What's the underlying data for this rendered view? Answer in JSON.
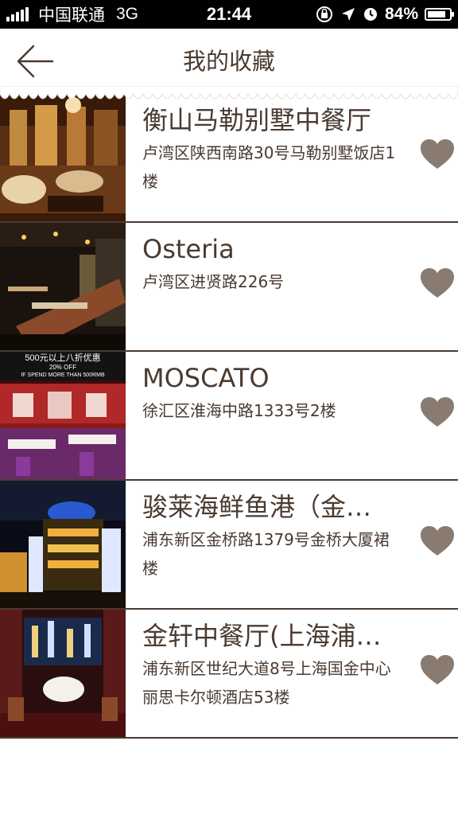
{
  "status_bar": {
    "carrier": "中国联通",
    "network": "3G",
    "time": "21:44",
    "battery": "84%",
    "battery_level": 0.84
  },
  "header": {
    "title": "我的收藏",
    "back_icon": "back-arrow-icon"
  },
  "colors": {
    "text": "#4a3a30",
    "heart": "#8a7b70",
    "divider": "#4a3a30"
  },
  "favorites": [
    {
      "name": "衡山马勒别墅中餐厅",
      "address": "卢湾区陕西南路30号马勒别墅饭店1楼"
    },
    {
      "name": "Osteria",
      "address": "卢湾区进贤路226号"
    },
    {
      "name": "MOSCATO",
      "address": "徐汇区淮海中路1333号2楼"
    },
    {
      "name": "骏莱海鲜鱼港（金…",
      "address": "浦东新区金桥路1379号金桥大厦裙楼"
    },
    {
      "name": "金轩中餐厅(上海浦…",
      "address": "浦东新区世纪大道8号上海国金中心丽思卡尔顿酒店53楼"
    }
  ],
  "promo_banner": {
    "line1": "500元以上八折优惠",
    "line2": "20% OFF",
    "line3": "IF SPEND MORE THAN 500RMB"
  }
}
